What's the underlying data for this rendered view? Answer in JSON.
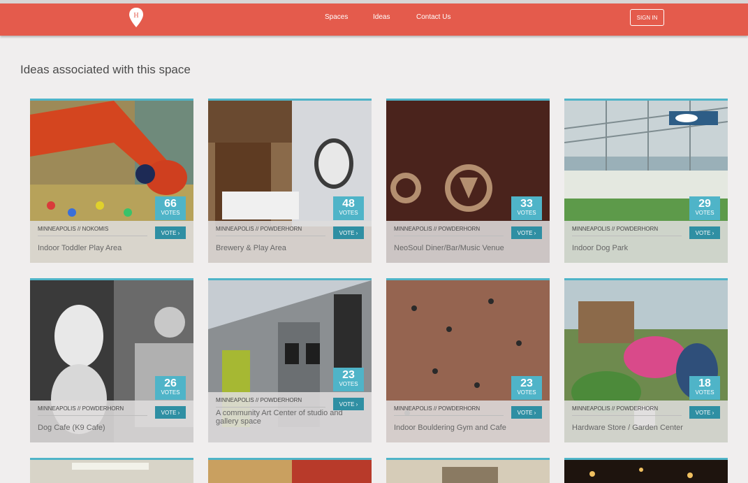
{
  "nav": {
    "links": [
      "Spaces",
      "Ideas",
      "Contact Us"
    ],
    "signin_label": "SIGN IN"
  },
  "page_title": "Ideas associated with this space",
  "cards": [
    {
      "votes": "66",
      "votes_label": "VOTES",
      "vote_label": "VOTE ›",
      "location": "MINNEAPOLIS // NOKOMIS",
      "title": "Indoor Toddler Play Area"
    },
    {
      "votes": "48",
      "votes_label": "VOTES",
      "vote_label": "VOTE ›",
      "location": "MINNEAPOLIS // POWDERHORN",
      "title": "Brewery & Play Area"
    },
    {
      "votes": "33",
      "votes_label": "VOTES",
      "vote_label": "VOTE ›",
      "location": "MINNEAPOLIS // POWDERHORN",
      "title": "NeoSoul Diner/Bar/Music Venue"
    },
    {
      "votes": "29",
      "votes_label": "VOTES",
      "vote_label": "VOTE ›",
      "location": "MINNEAPOLIS // POWDERHORN",
      "title": "Indoor Dog Park"
    },
    {
      "votes": "26",
      "votes_label": "VOTES",
      "vote_label": "VOTE ›",
      "location": "MINNEAPOLIS // POWDERHORN",
      "title": "Dog Cafe (K9 Cafe)"
    },
    {
      "votes": "23",
      "votes_label": "VOTES",
      "vote_label": "VOTE ›",
      "location": "MINNEAPOLIS // POWDERHORN",
      "title": "A community Art Center of studio and gallery space"
    },
    {
      "votes": "23",
      "votes_label": "VOTES",
      "vote_label": "VOTE ›",
      "location": "MINNEAPOLIS // POWDERHORN",
      "title": "Indoor Bouldering Gym and Cafe"
    },
    {
      "votes": "18",
      "votes_label": "VOTES",
      "vote_label": "VOTE ›",
      "location": "MINNEAPOLIS // POWDERHORN",
      "title": "Hardware Store / Garden Center"
    }
  ],
  "colors": {
    "navbar": "#e45b4c",
    "accent": "#4fb4c8",
    "vote_button": "#2f8fa3",
    "background": "#f0eeee"
  },
  "icons": {
    "logo": "location-pin-logo-icon"
  }
}
